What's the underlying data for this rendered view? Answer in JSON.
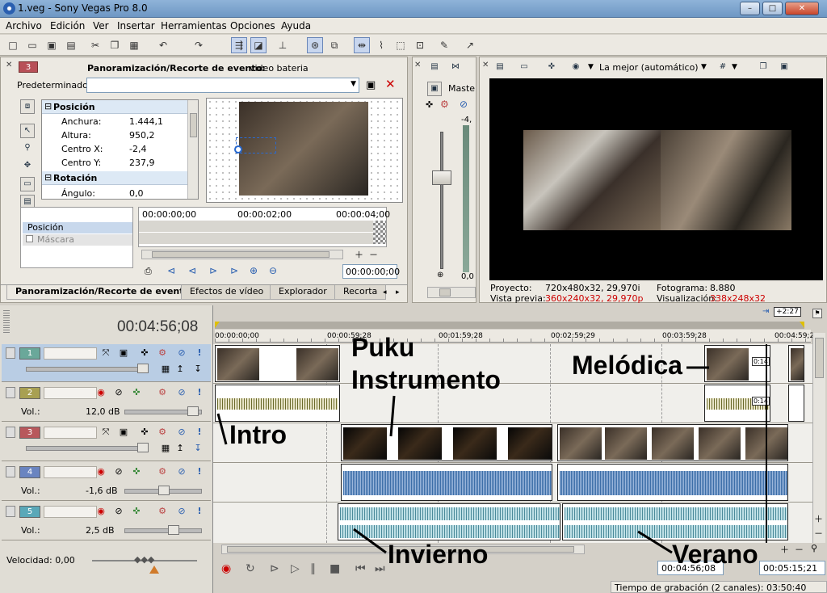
{
  "window": {
    "title": "1.veg - Sony Vegas Pro 8.0",
    "min": "–",
    "max": "□",
    "close": "✕"
  },
  "menu": [
    "Archivo",
    "Edición",
    "Ver",
    "Insertar",
    "Herramientas",
    "Opciones",
    "Ayuda"
  ],
  "event_panel": {
    "badge": "3",
    "header_bold": "Panoramización/Recorte de evento:",
    "header_rest": " video bateria",
    "preset_label": "Predeterminado:",
    "sections": {
      "position": "Posición",
      "rotation": "Rotación"
    },
    "props": [
      {
        "label": "Anchura:",
        "value": "1.444,1"
      },
      {
        "label": "Altura:",
        "value": "950,2"
      },
      {
        "label": "Centro X:",
        "value": "-2,4"
      },
      {
        "label": "Centro Y:",
        "value": "237,9"
      }
    ],
    "angle": {
      "label": "Ángulo:",
      "value": "0,0"
    },
    "kf_rows": {
      "position": "Posición",
      "mask": "Máscara"
    },
    "kf_times": [
      "00:00:00;00",
      "00:00:02;00",
      "00:00:04;00"
    ],
    "kf_cursor": "00:00:00;00"
  },
  "tabs": [
    "Panoramización/Recorte de event",
    "Efectos de vídeo",
    "Explorador",
    "Recorta"
  ],
  "master": {
    "label": "Maste",
    "db_top": "-4,",
    "db_bottom": "0,0"
  },
  "preview": {
    "quality": "La mejor (automático)",
    "info": {
      "proyecto_label": "Proyecto:",
      "proyecto_value": "720x480x32, 29,970i",
      "fotograma_label": "Fotograma:",
      "fotograma_value": "8.880",
      "vista_label": "Vista previa:",
      "vista_value": "360x240x32, 29,970p",
      "visual_label": "Visualización:",
      "visual_value": "338x248x32"
    },
    "accent_red": "#cc0000"
  },
  "timeline": {
    "cursor_time": "00:04:56;08",
    "ruler": [
      "00:00:00;00",
      "00:00:59;28",
      "00:01:59;28",
      "00:02:59;29",
      "00:03:59;28",
      "00:04:59;2"
    ],
    "marker": "+2:27",
    "speed": "Velocidad: 0,00",
    "end_time": "00:04:56;08",
    "end_time2": "00:05:15;21",
    "status": "Tiempo de grabación (2 canales): 03:50:40",
    "clip_badge": "0:14"
  },
  "tracks": [
    {
      "num": "1",
      "type": "video",
      "color": "#6aa89a"
    },
    {
      "num": "2",
      "type": "audio",
      "vol_label": "Vol.:",
      "vol_value": "12,0 dB",
      "color": "#a8a052"
    },
    {
      "num": "3",
      "type": "video",
      "color": "#b8585c"
    },
    {
      "num": "4",
      "type": "audio",
      "vol_label": "Vol.:",
      "vol_value": "-1,6 dB",
      "color": "#6a84c0"
    },
    {
      "num": "5",
      "type": "audio",
      "vol_label": "Vol.:",
      "vol_value": "2,5 dB",
      "color": "#5aa8b8"
    }
  ],
  "annotations": {
    "puku": "Puku",
    "instrumento": "Instrumento",
    "melodica": "Melódica",
    "intro": "Intro",
    "invierno": "Invierno",
    "verano": "Verano"
  }
}
